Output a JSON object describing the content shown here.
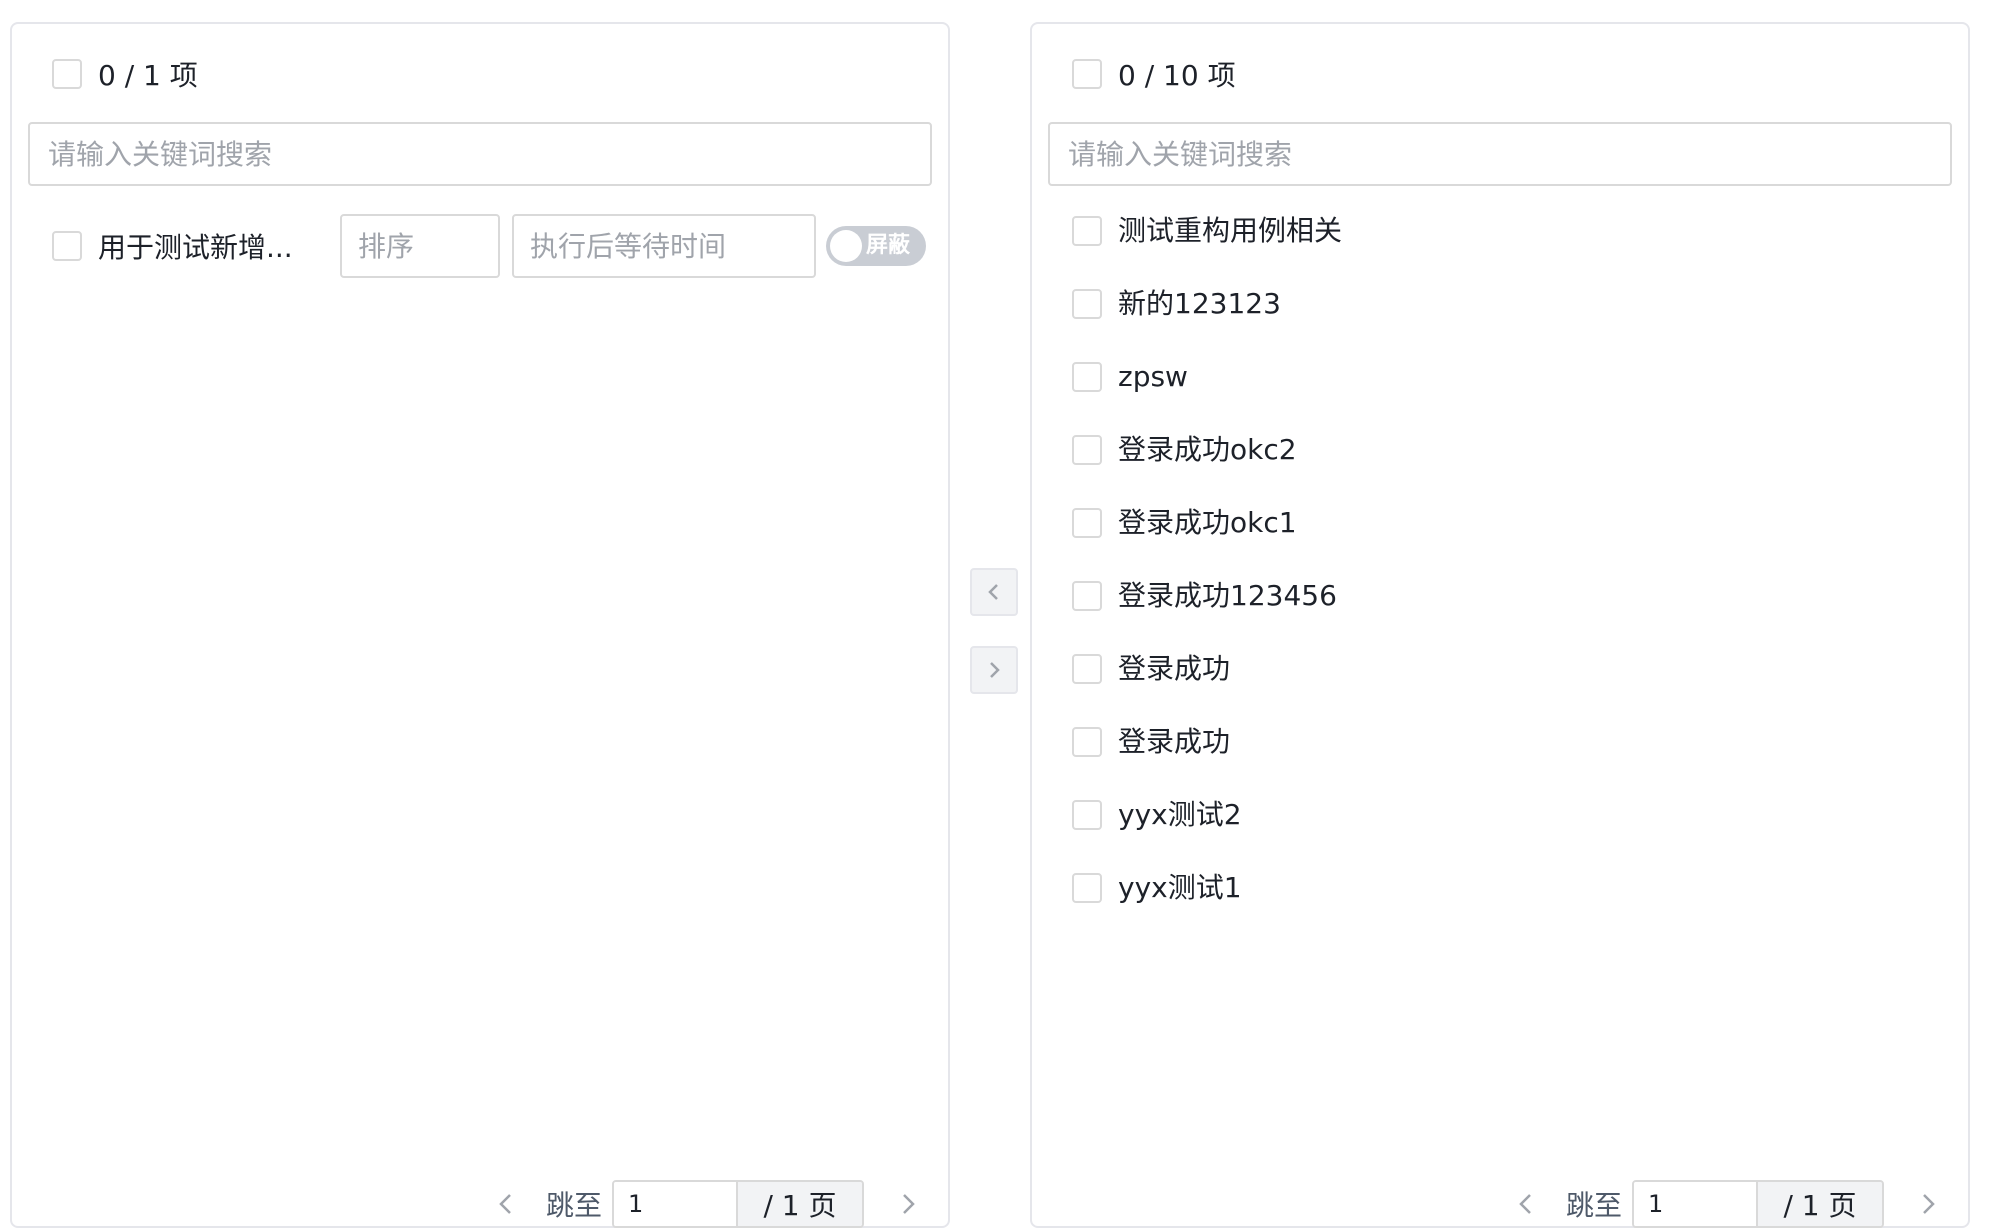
{
  "left_panel": {
    "count": "0 / 1 项",
    "search_placeholder": "请输入关键词搜索",
    "item": {
      "label": "用于测试新增...",
      "sort_placeholder": "排序",
      "wait_placeholder": "执行后等待时间",
      "toggle_label": "屏蔽",
      "toggle_on": false
    },
    "pager": {
      "prev_icon": "chevron-left-icon",
      "jump_label": "跳至",
      "page_value": "1",
      "total": "/ 1 页",
      "next_icon": "chevron-right-icon"
    }
  },
  "transfer": {
    "to_left_icon": "chevron-left-icon",
    "to_right_icon": "chevron-right-icon"
  },
  "right_panel": {
    "count": "0 / 10 项",
    "search_placeholder": "请输入关键词搜索",
    "items": [
      {
        "label": "测试重构用例相关"
      },
      {
        "label": "新的123123"
      },
      {
        "label": "zpsw"
      },
      {
        "label": "登录成功okc2"
      },
      {
        "label": "登录成功okc1"
      },
      {
        "label": "登录成功123456"
      },
      {
        "label": "登录成功"
      },
      {
        "label": "登录成功"
      },
      {
        "label": "yyx测试2"
      },
      {
        "label": "yyx测试1"
      }
    ],
    "pager": {
      "prev_icon": "chevron-left-icon",
      "jump_label": "跳至",
      "page_value": "1",
      "total": "/ 1 页",
      "next_icon": "chevron-right-icon"
    }
  }
}
